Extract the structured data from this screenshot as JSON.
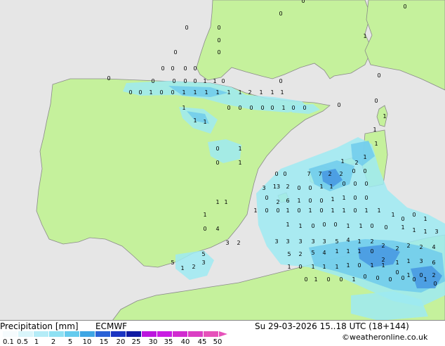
{
  "map": {
    "colors": {
      "sea": "#e6e6e6",
      "land": "#c5f19c",
      "coast": "#8a8a8a",
      "precip_light": "#9eeaf2",
      "precip_mid": "#6cc9ec",
      "precip_heavy": "#3f8fe0"
    },
    "values": [
      "0",
      "0",
      "0",
      "0",
      "1",
      "0",
      "0",
      "0",
      "0",
      "0",
      "0",
      "0",
      "0",
      "0",
      "0",
      "0",
      "0",
      "0",
      "1",
      "1",
      "0",
      "0",
      "0",
      "0",
      "0",
      "1",
      "0",
      "0",
      "1",
      "1",
      "1",
      "1",
      "1",
      "1",
      "2",
      "1",
      "1",
      "1",
      "0",
      "0",
      "0",
      "0",
      "0",
      "1",
      "0",
      "0",
      "0",
      "1",
      "1",
      "1",
      "0",
      "1",
      "1",
      "1",
      "0",
      "1",
      "0",
      "1",
      "1",
      "1",
      "0",
      "0",
      "7",
      "7",
      "2",
      "2",
      "0",
      "0",
      "2",
      "3",
      "13",
      "2",
      "0",
      "0",
      "1",
      "1",
      "0",
      "0",
      "0",
      "1",
      "1",
      "0",
      "2",
      "6",
      "1",
      "0",
      "0",
      "1",
      "1",
      "0",
      "0",
      "1",
      "1",
      "0",
      "0",
      "1",
      "0",
      "1",
      "0",
      "1",
      "1",
      "0",
      "1",
      "1",
      "1",
      "0",
      "0",
      "1",
      "0",
      "4",
      "1",
      "1",
      "0",
      "0",
      "0",
      "1",
      "1",
      "0",
      "0",
      "1",
      "1",
      "1",
      "3",
      "3",
      "2",
      "3",
      "3",
      "3",
      "3",
      "3",
      "5",
      "4",
      "1",
      "2",
      "2",
      "2",
      "2",
      "2",
      "4",
      "5",
      "5",
      "2",
      "5",
      "4",
      "1",
      "1",
      "1",
      "0",
      "2",
      "1",
      "1",
      "3",
      "6",
      "5",
      "1",
      "2",
      "3",
      "1",
      "0",
      "1",
      "1",
      "1",
      "1",
      "0",
      "1",
      "1",
      "0",
      "1",
      "0",
      "2",
      "0",
      "1",
      "0",
      "0",
      "1",
      "0",
      "0",
      "0",
      "0",
      "0",
      "1",
      "0"
    ]
  },
  "legend": {
    "title": "Precipitation [mm]",
    "model": "ECMWF",
    "datetime": "Su 29-03-2026 15..18 UTC (18+144)",
    "credit": "©weatheronline.co.uk",
    "scale_labels": [
      "0.1",
      "0.5",
      "1",
      "2",
      "5",
      "10",
      "15",
      "20",
      "25",
      "30",
      "35",
      "40",
      "45",
      "50"
    ],
    "scale_colors": [
      "#f5fbfd",
      "#d9f5fa",
      "#b4ecf7",
      "#8fe1f3",
      "#65cbee",
      "#3fa6e4",
      "#2a62d6",
      "#1a34c2",
      "#101aa2",
      "#bb16de",
      "#c91ee3",
      "#d12cd0",
      "#db3fc4",
      "#e652ba"
    ]
  }
}
